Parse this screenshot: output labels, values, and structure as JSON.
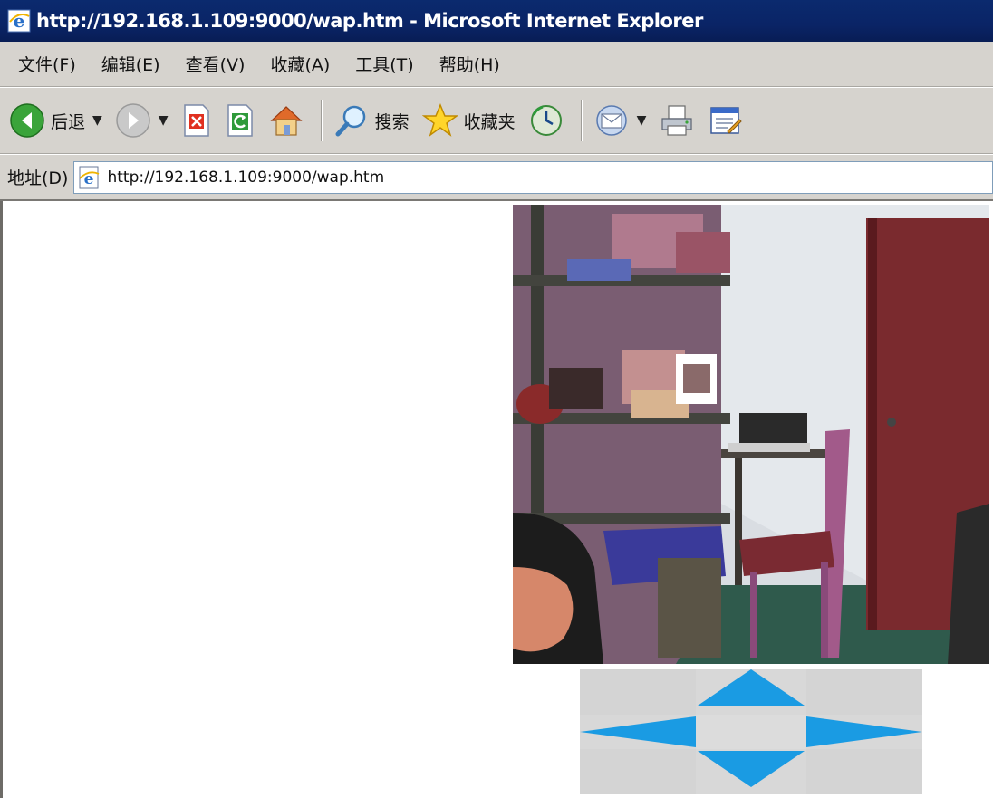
{
  "window": {
    "title": "http://192.168.1.109:9000/wap.htm - Microsoft Internet Explorer"
  },
  "menu": {
    "items": [
      "文件(F)",
      "编辑(E)",
      "查看(V)",
      "收藏(A)",
      "工具(T)",
      "帮助(H)"
    ]
  },
  "toolbar": {
    "back_label": "后退",
    "search_label": "搜索",
    "favorites_label": "收藏夹"
  },
  "address": {
    "label": "地址(D)",
    "url": "http://192.168.1.109:9000/wap.htm"
  },
  "icons": {
    "back": "back-arrow-icon",
    "forward": "forward-arrow-icon",
    "stop": "stop-icon",
    "refresh": "refresh-icon",
    "home": "home-icon",
    "search": "search-icon",
    "favorites": "favorites-star-icon",
    "history": "history-icon",
    "mail": "mail-icon",
    "print": "print-icon",
    "edit": "edit-icon"
  },
  "colors": {
    "titlebar": "#0a2466",
    "chrome": "#d6d3ce",
    "arrow": "#1a9be3",
    "pad": "#d8d8d8"
  },
  "controls": {
    "directions": [
      "up",
      "left",
      "right",
      "down"
    ]
  }
}
